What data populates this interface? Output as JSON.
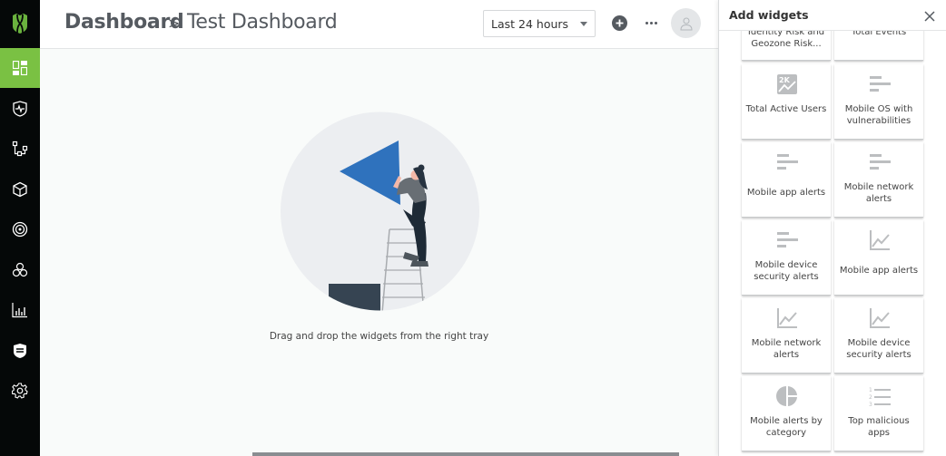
{
  "sidebar": {
    "logo": "shield-logo",
    "items": [
      {
        "name": "dashboard",
        "icon": "dashboard-icon",
        "active": true
      },
      {
        "name": "security",
        "icon": "shield-pulse-icon",
        "active": false
      },
      {
        "name": "hierarchy",
        "icon": "hierarchy-icon",
        "active": false
      },
      {
        "name": "packages",
        "icon": "cube-icon",
        "active": false
      },
      {
        "name": "target",
        "icon": "target-icon",
        "active": false
      },
      {
        "name": "integrations",
        "icon": "webhook-icon",
        "active": false
      },
      {
        "name": "reports",
        "icon": "bar-chart-icon",
        "active": false
      },
      {
        "name": "policies",
        "icon": "shield-list-icon",
        "active": false
      },
      {
        "name": "settings",
        "icon": "gear-icon",
        "active": false
      }
    ]
  },
  "header": {
    "breadcrumb_root": "Dashboard",
    "breadcrumb_separator": ">",
    "breadcrumb_current": "Test Dashboard",
    "time_range": "Last 24 hours"
  },
  "main": {
    "empty_message": "Drag and drop the widgets from the right tray"
  },
  "panel": {
    "title": "Add widgets",
    "tiles": [
      {
        "label": "Identity Risk and Geozone Risk...",
        "icon": "none"
      },
      {
        "label": "Total Events",
        "icon": "none"
      },
      {
        "label": "Total Active Users",
        "icon": "kpi-icon"
      },
      {
        "label": "Mobile OS with vulnerabilities",
        "icon": "bar-list-icon"
      },
      {
        "label": "Mobile app alerts",
        "icon": "bar-list-icon"
      },
      {
        "label": "Mobile network alerts",
        "icon": "bar-list-icon"
      },
      {
        "label": "Mobile device security alerts",
        "icon": "bar-list-icon"
      },
      {
        "label": "Mobile app alerts",
        "icon": "line-chart-icon"
      },
      {
        "label": "Mobile network alerts",
        "icon": "line-chart-icon"
      },
      {
        "label": "Mobile device security alerts",
        "icon": "line-chart-icon"
      },
      {
        "label": "Mobile alerts by category",
        "icon": "pie-chart-icon"
      },
      {
        "label": "Top malicious apps",
        "icon": "numbered-list-icon"
      }
    ]
  },
  "colors": {
    "accent": "#7ac143",
    "sidebar_bg": "#050808",
    "illustration_blue": "#2f72bd"
  }
}
